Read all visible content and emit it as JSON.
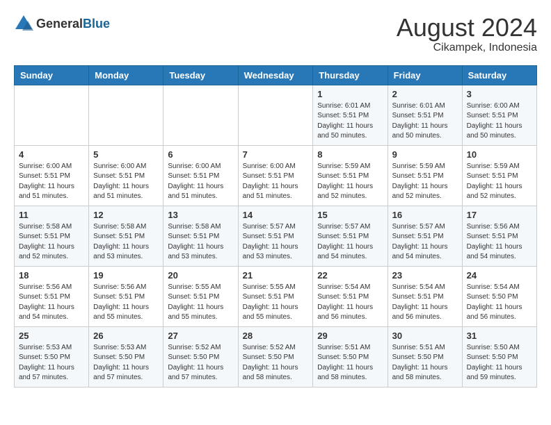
{
  "header": {
    "logo": {
      "general": "General",
      "blue": "Blue"
    },
    "title": "August 2024",
    "location": "Cikampek, Indonesia"
  },
  "days_of_week": [
    "Sunday",
    "Monday",
    "Tuesday",
    "Wednesday",
    "Thursday",
    "Friday",
    "Saturday"
  ],
  "weeks": [
    [
      {
        "day": "",
        "content": ""
      },
      {
        "day": "",
        "content": ""
      },
      {
        "day": "",
        "content": ""
      },
      {
        "day": "",
        "content": ""
      },
      {
        "day": "1",
        "content": "Sunrise: 6:01 AM\nSunset: 5:51 PM\nDaylight: 11 hours and 50 minutes."
      },
      {
        "day": "2",
        "content": "Sunrise: 6:01 AM\nSunset: 5:51 PM\nDaylight: 11 hours and 50 minutes."
      },
      {
        "day": "3",
        "content": "Sunrise: 6:00 AM\nSunset: 5:51 PM\nDaylight: 11 hours and 50 minutes."
      }
    ],
    [
      {
        "day": "4",
        "content": "Sunrise: 6:00 AM\nSunset: 5:51 PM\nDaylight: 11 hours and 51 minutes."
      },
      {
        "day": "5",
        "content": "Sunrise: 6:00 AM\nSunset: 5:51 PM\nDaylight: 11 hours and 51 minutes."
      },
      {
        "day": "6",
        "content": "Sunrise: 6:00 AM\nSunset: 5:51 PM\nDaylight: 11 hours and 51 minutes."
      },
      {
        "day": "7",
        "content": "Sunrise: 6:00 AM\nSunset: 5:51 PM\nDaylight: 11 hours and 51 minutes."
      },
      {
        "day": "8",
        "content": "Sunrise: 5:59 AM\nSunset: 5:51 PM\nDaylight: 11 hours and 52 minutes."
      },
      {
        "day": "9",
        "content": "Sunrise: 5:59 AM\nSunset: 5:51 PM\nDaylight: 11 hours and 52 minutes."
      },
      {
        "day": "10",
        "content": "Sunrise: 5:59 AM\nSunset: 5:51 PM\nDaylight: 11 hours and 52 minutes."
      }
    ],
    [
      {
        "day": "11",
        "content": "Sunrise: 5:58 AM\nSunset: 5:51 PM\nDaylight: 11 hours and 52 minutes."
      },
      {
        "day": "12",
        "content": "Sunrise: 5:58 AM\nSunset: 5:51 PM\nDaylight: 11 hours and 53 minutes."
      },
      {
        "day": "13",
        "content": "Sunrise: 5:58 AM\nSunset: 5:51 PM\nDaylight: 11 hours and 53 minutes."
      },
      {
        "day": "14",
        "content": "Sunrise: 5:57 AM\nSunset: 5:51 PM\nDaylight: 11 hours and 53 minutes."
      },
      {
        "day": "15",
        "content": "Sunrise: 5:57 AM\nSunset: 5:51 PM\nDaylight: 11 hours and 54 minutes."
      },
      {
        "day": "16",
        "content": "Sunrise: 5:57 AM\nSunset: 5:51 PM\nDaylight: 11 hours and 54 minutes."
      },
      {
        "day": "17",
        "content": "Sunrise: 5:56 AM\nSunset: 5:51 PM\nDaylight: 11 hours and 54 minutes."
      }
    ],
    [
      {
        "day": "18",
        "content": "Sunrise: 5:56 AM\nSunset: 5:51 PM\nDaylight: 11 hours and 54 minutes."
      },
      {
        "day": "19",
        "content": "Sunrise: 5:56 AM\nSunset: 5:51 PM\nDaylight: 11 hours and 55 minutes."
      },
      {
        "day": "20",
        "content": "Sunrise: 5:55 AM\nSunset: 5:51 PM\nDaylight: 11 hours and 55 minutes."
      },
      {
        "day": "21",
        "content": "Sunrise: 5:55 AM\nSunset: 5:51 PM\nDaylight: 11 hours and 55 minutes."
      },
      {
        "day": "22",
        "content": "Sunrise: 5:54 AM\nSunset: 5:51 PM\nDaylight: 11 hours and 56 minutes."
      },
      {
        "day": "23",
        "content": "Sunrise: 5:54 AM\nSunset: 5:51 PM\nDaylight: 11 hours and 56 minutes."
      },
      {
        "day": "24",
        "content": "Sunrise: 5:54 AM\nSunset: 5:50 PM\nDaylight: 11 hours and 56 minutes."
      }
    ],
    [
      {
        "day": "25",
        "content": "Sunrise: 5:53 AM\nSunset: 5:50 PM\nDaylight: 11 hours and 57 minutes."
      },
      {
        "day": "26",
        "content": "Sunrise: 5:53 AM\nSunset: 5:50 PM\nDaylight: 11 hours and 57 minutes."
      },
      {
        "day": "27",
        "content": "Sunrise: 5:52 AM\nSunset: 5:50 PM\nDaylight: 11 hours and 57 minutes."
      },
      {
        "day": "28",
        "content": "Sunrise: 5:52 AM\nSunset: 5:50 PM\nDaylight: 11 hours and 58 minutes."
      },
      {
        "day": "29",
        "content": "Sunrise: 5:51 AM\nSunset: 5:50 PM\nDaylight: 11 hours and 58 minutes."
      },
      {
        "day": "30",
        "content": "Sunrise: 5:51 AM\nSunset: 5:50 PM\nDaylight: 11 hours and 58 minutes."
      },
      {
        "day": "31",
        "content": "Sunrise: 5:50 AM\nSunset: 5:50 PM\nDaylight: 11 hours and 59 minutes."
      }
    ]
  ]
}
